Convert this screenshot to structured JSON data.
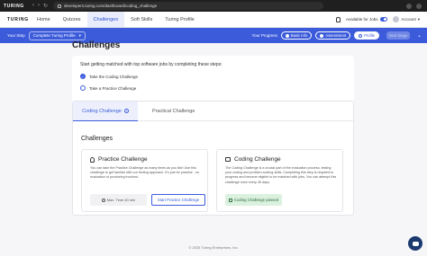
{
  "browser": {
    "tab_label": "TURING",
    "url": "developers.turing.com/dashboard/coding_challenge"
  },
  "header": {
    "brand": "TURING",
    "nav": [
      "Home",
      "Quizzes",
      "Challenges",
      "Soft Skills",
      "Turing Profile"
    ],
    "available_label": "Available for Jobs",
    "account_label": "Account"
  },
  "step_bar": {
    "your_step_label": "Your Step",
    "step_value": "Complete Turing Profile",
    "progress_label": "Your Progress",
    "pills": [
      "Basic Info",
      "Assessment",
      "Profile"
    ],
    "next_label": "Next Stage"
  },
  "page_title": "Challenges",
  "intro": {
    "heading": "Start getting matched with top software jobs by completing these steps:",
    "steps": [
      "Take the Coding Challenge",
      "Take a Practice Challenge"
    ]
  },
  "tabs": [
    "Coding Challenge",
    "Practical Challenge"
  ],
  "section_title": "Challenges",
  "practice_card": {
    "title": "Practice Challenge",
    "description": "You can take the Practice Challenge as many times as you like! Use this challenge to get familiar with our testing approach. It's just for practice - no evaluation or proctoring involved.",
    "time_label": "Max. Time 40 min",
    "start_label": "Start Practice Challenge"
  },
  "coding_card": {
    "title": "Coding Challenge",
    "description": "The Coding Challenge is a crucial part of the evaluation process, testing your coding and problem-solving skills. Completing this step is required to progress and become eligible to be matched with jobs. You can attempt this challenge once every 45 days.",
    "passed_label": "Coding Challenge passed"
  },
  "footer": "© 2025 Turing Enterprises, Inc.",
  "colors": {
    "accent": "#3b5bdb",
    "passed_bg": "#dbf1df"
  }
}
